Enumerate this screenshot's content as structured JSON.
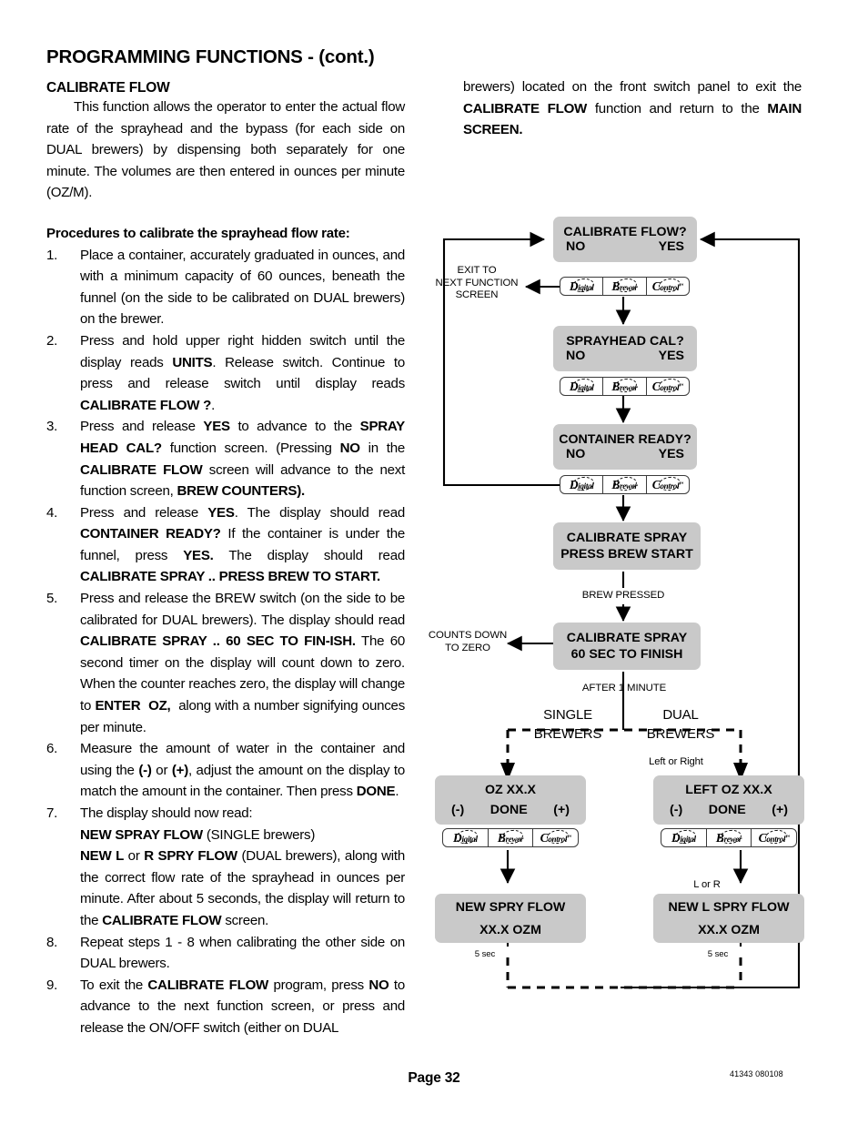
{
  "header": {
    "title": "PROGRAMMING FUNCTIONS - (cont.)",
    "section": "CALIBRATE FLOW"
  },
  "intro": "This function allows the operator to enter the actual flow rate of the sprayhead and the bypass (for each side on DUAL brewers) by dispensing both separately for one minute. The volumes are then entered in ounces per minute (OZ/M).",
  "procedures_heading": "Procedures to calibrate the sprayhead flow rate:",
  "steps": [
    {
      "num": "1.",
      "text": "Place a container, accurately graduated in ounces, and with a minimum capacity of 60 ounces, beneath the funnel (on the side to be calibrated on DUAL brewers) on the brewer."
    },
    {
      "num": "2.",
      "text": "Press and hold upper right hidden switch until the display reads UNITS. Release switch. Continue to press and release switch until display reads CALIBRATE FLOW ?."
    },
    {
      "num": "3.",
      "text": "Press and release YES to advance to the SPRAY HEAD CAL? function screen. (Pressing NO in the CALIBRATE FLOW screen will advance to the next function screen, BREW COUNTERS)."
    },
    {
      "num": "4.",
      "text": "Press and release YES. The display should read CONTAINER READY? If the container is under the funnel, press YES. The display should read CALIBRATE SPRAY .. PRESS BREW TO START."
    },
    {
      "num": "5.",
      "text": "Press and release the BREW switch (on the side to be calibrated for DUAL brewers). The display should read CALIBRATE SPRAY .. 60 SEC TO FINISH. The 60 second timer on the display will count down to zero. When the counter reaches zero, the display will change to ENTER OZ, along with a number signifying ounces per minute."
    },
    {
      "num": "6.",
      "text": "Measure the amount of water in the container and using the (-) or (+), adjust the amount on the display to match the amount in the container. Then press DONE."
    },
    {
      "num": "7.",
      "text": "The display should now read: NEW SPRAY FLOW (SINGLE brewers) NEW L or R SPRY FLOW (DUAL brewers), along with the correct flow rate of the sprayhead in ounces per minute. After about 5 seconds, the display will return to the CALIBRATE FLOW screen."
    },
    {
      "num": "8.",
      "text": "Repeat steps 1 - 8 when calibrating the other side on DUAL brewers."
    },
    {
      "num": "9.",
      "text": "To exit the CALIBRATE FLOW program, press NO to advance to the next function screen, or press and release the ON/OFF switch (either on DUAL"
    }
  ],
  "right_column": "brewers) located on the front switch panel to exit the CALIBRATE FLOW function and return to the MAIN SCREEN.",
  "flowchart": {
    "keypad": {
      "d": "D",
      "d_rest": "igital",
      "b": "B",
      "b_rest": "rewer",
      "c": "C",
      "c_rest": "ontrol",
      "tm": "™"
    },
    "boxes": {
      "calibrate_flow": {
        "title": "CALIBRATE FLOW?",
        "no": "NO",
        "yes": "YES"
      },
      "sprayhead_cal": {
        "title": "SPRAYHEAD CAL?",
        "no": "NO",
        "yes": "YES"
      },
      "container_ready": {
        "title": "CONTAINER READY?",
        "no": "NO",
        "yes": "YES"
      },
      "calibrate_spray_start": {
        "line1": "CALIBRATE SPRAY",
        "line2": "PRESS  BREW  START"
      },
      "calibrate_spray_finish": {
        "line1": "CALIBRATE SPRAY",
        "line2": "60  SEC  TO  FINISH"
      },
      "oz_single": {
        "title": "OZ XX.X",
        "minus": "(-)",
        "done": "DONE",
        "plus": "(+)"
      },
      "oz_dual": {
        "title": "LEFT OZ XX.X",
        "minus": "(-)",
        "done": "DONE",
        "plus": "(+)"
      },
      "new_spry_single": {
        "line1": "NEW SPRY FLOW",
        "line2": "XX.X  OZM"
      },
      "new_spry_dual": {
        "line1": "NEW L SPRY FLOW",
        "line2": "XX.X  OZM"
      }
    },
    "labels": {
      "exit_to": "EXIT TO",
      "next_function": "NEXT FUNCTION",
      "screen": "SCREEN",
      "brew_pressed": "BREW PRESSED",
      "counts_down": "COUNTS DOWN",
      "to_zero": "TO ZERO",
      "after_one_minute": "AFTER 1 MINUTE",
      "single": "SINGLE",
      "single_brewers": "BREWERS",
      "dual": "DUAL",
      "dual_brewers": "BREWERS",
      "left_or_right": "Left or Right",
      "l_or_r": "L or R",
      "five_sec_left": "5 sec",
      "five_sec_right": "5 sec"
    }
  },
  "footer": {
    "page": "Page 32",
    "doc_code": "41343 080108"
  }
}
